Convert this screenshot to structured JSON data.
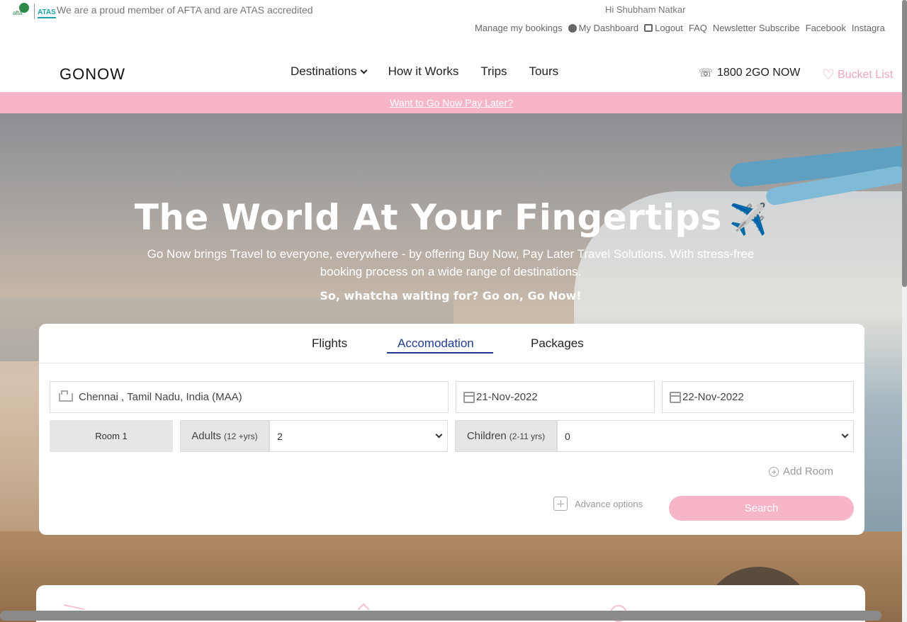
{
  "topbar": {
    "logos": {
      "afta": "afta",
      "atas": "ATAS"
    },
    "member_text": "We are a proud member of AFTA and are ATAS accredited",
    "greeting": "Hi Shubham Natkar",
    "links": {
      "manage_bookings": "Manage my bookings",
      "dashboard": "My Dashboard",
      "logout": "Logout",
      "faq": "FAQ",
      "newsletter": "Newsletter Subscribe",
      "facebook": "Facebook",
      "instagram": "Instagra"
    }
  },
  "nav": {
    "brand": "GONOW",
    "links": {
      "destinations": "Destinations",
      "how_it_works": "How it Works",
      "trips": "Trips",
      "tours": "Tours"
    },
    "phone": "1800 2GO NOW",
    "bucket_list": "Bucket List"
  },
  "banner": {
    "link": "Want to Go Now Pay Later?"
  },
  "hero": {
    "title": "The World At Your Fingertips",
    "title_emoji": "✈️",
    "subtitle": "Go Now brings Travel to everyone, everywhere - by offering Buy Now, Pay Later Travel Solutions. With stress-free booking process on a wide range of destinations.",
    "tagline": "So, whatcha waiting for? Go on, Go Now!"
  },
  "search": {
    "tabs": {
      "flights": "Flights",
      "accommodation": "Accomodation",
      "packages": "Packages"
    },
    "location": "Chennai , Tamil Nadu, India (MAA)",
    "checkin": "21-Nov-2022",
    "checkout": "22-Nov-2022",
    "room_label": "Room 1",
    "adults_label": "Adults",
    "adults_range": "(12 +yrs)",
    "adults_value": "2",
    "children_label": "Children",
    "children_range": "(2-11 yrs)",
    "children_value": "0",
    "add_room": "Add Room",
    "advance_options": "Advance options",
    "search_button": "Search"
  },
  "colors": {
    "accent_pink": "#f6b6c8",
    "tab_active": "#1f3a93"
  }
}
